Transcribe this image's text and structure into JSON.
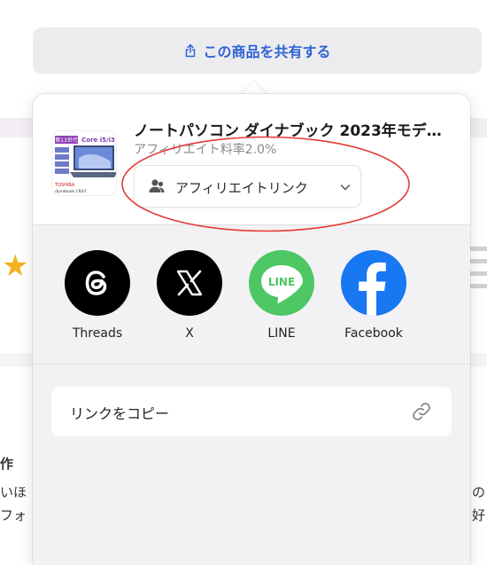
{
  "share_button": {
    "label": "この商品を共有する"
  },
  "product": {
    "title": "ノートパソコン ダイナブック 2023年モデ…",
    "rate": "アフィリエイト料率2.0%",
    "thumb_badge": "第13世代",
    "thumb_cpu": "Core i5/i3",
    "thumb_brand": "TOSHIBA",
    "thumb_model": "dynabook C6/LY"
  },
  "affiliate_select": {
    "label": "アフィリエイトリンク"
  },
  "targets": [
    {
      "name": "Threads",
      "color": "#000000"
    },
    {
      "name": "X",
      "color": "#000000"
    },
    {
      "name": "LINE",
      "color": "#4cc764",
      "logo_text": "LINE"
    },
    {
      "name": "Facebook",
      "color": "#1877f2"
    }
  ],
  "copy_link": {
    "label": "リンクをコピー"
  },
  "background": {
    "frag_1": "作",
    "frag_2": "いほ",
    "frag_3": "フォ",
    "frag_4": "の",
    "frag_5": "好"
  }
}
